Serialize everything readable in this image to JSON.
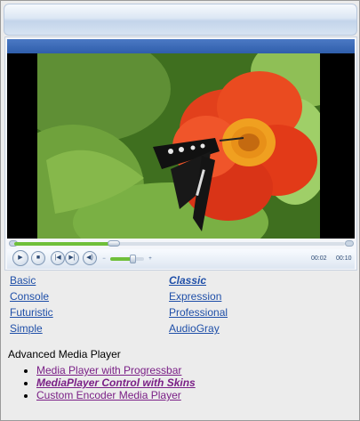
{
  "player": {
    "current_time": "00:02",
    "total_time": "00:10",
    "progress": 0.3,
    "volume": 0.65,
    "controls": {
      "play_icon": "play-icon",
      "stop_icon": "stop-icon",
      "prev_icon": "previous-icon",
      "next_icon": "next-icon",
      "mute_icon": "speaker-icon"
    }
  },
  "skins": {
    "left": [
      "Basic",
      "Console",
      "Futuristic",
      "Simple"
    ],
    "right": [
      "Classic",
      "Expression",
      "Professional",
      "AudioGray"
    ],
    "selected": "Classic"
  },
  "section_heading": "Advanced Media Player",
  "examples": [
    {
      "label": "Media Player with Progressbar",
      "current": false
    },
    {
      "label": "MediaPlayer Control with Skins",
      "current": true
    },
    {
      "label": "Custom Encoder Media Player",
      "current": false
    }
  ],
  "colors": {
    "accent": "#2f5eab",
    "progress": "#6fbf3a",
    "link": "#1f4fa8",
    "visited_link": "#7a1f86"
  }
}
